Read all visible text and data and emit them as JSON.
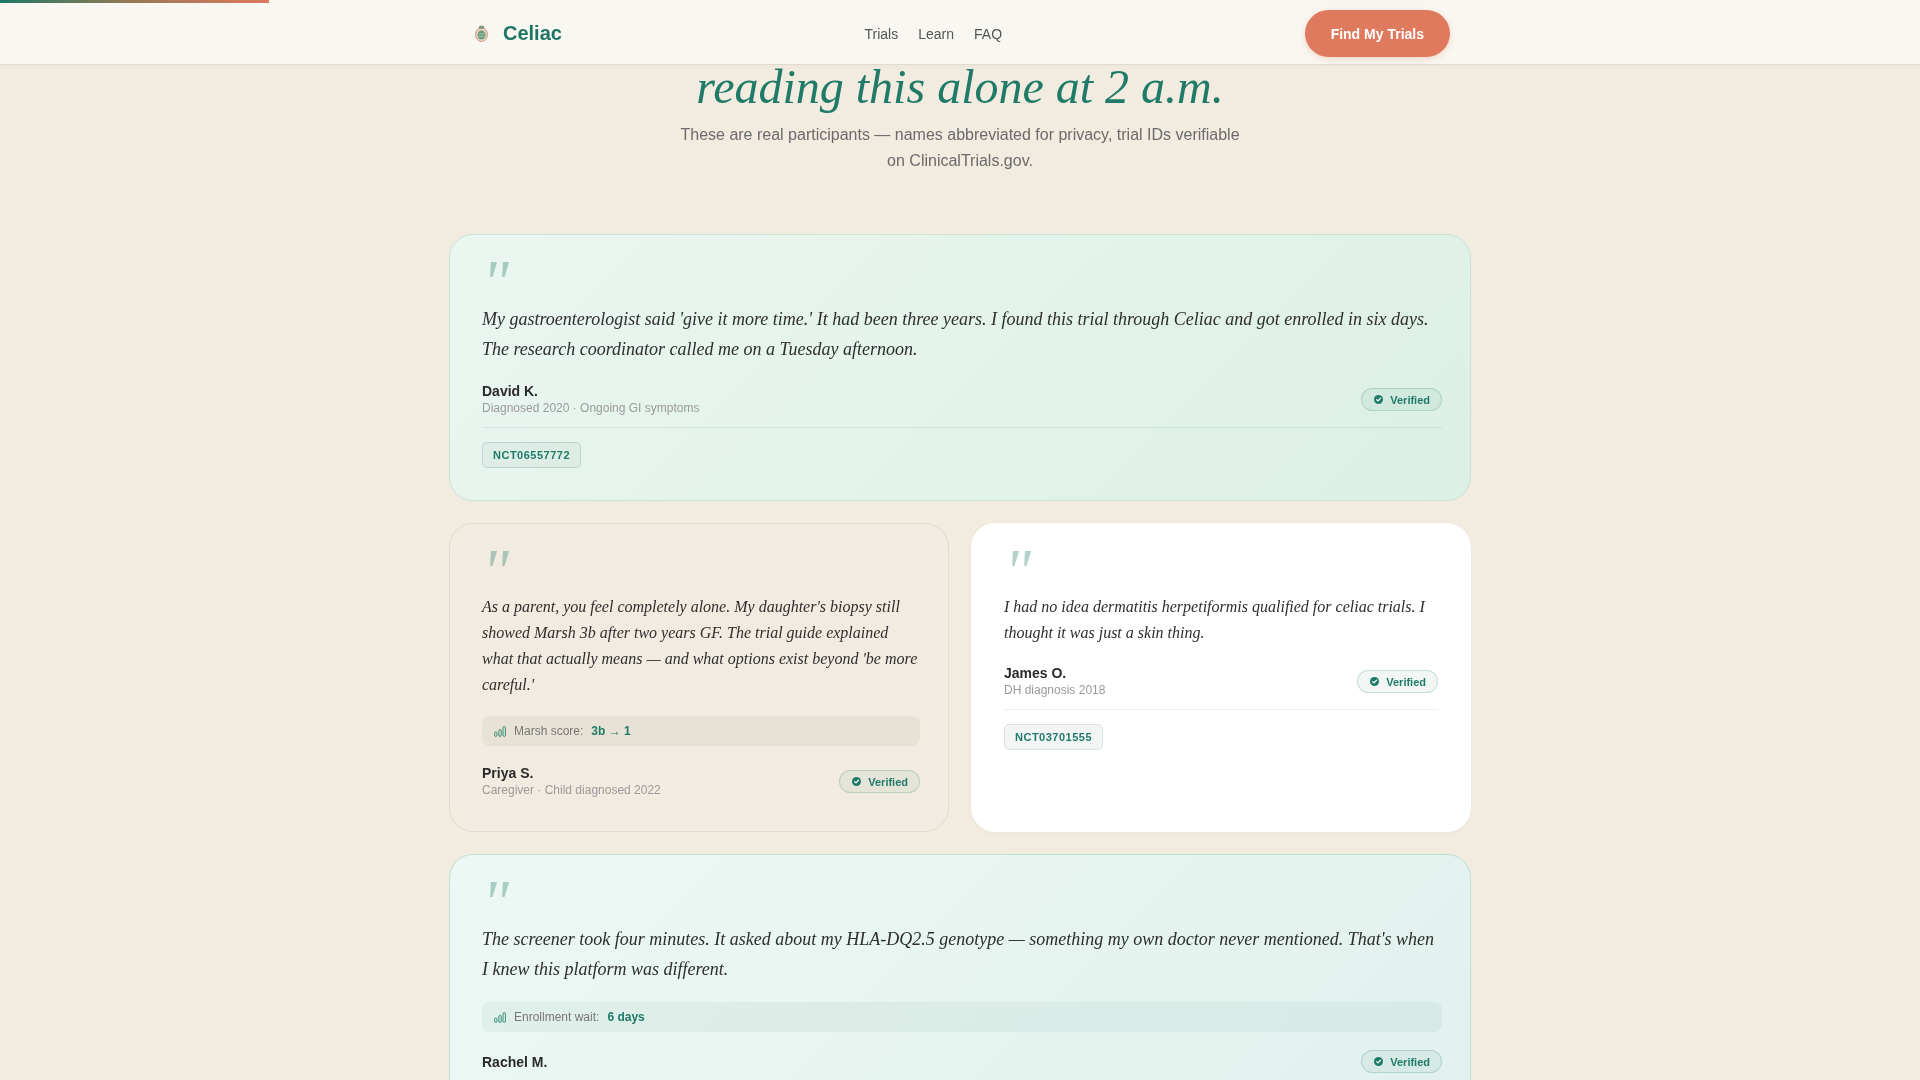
{
  "progress_bar": {
    "level": 0.14
  },
  "header": {
    "logo": "Celiac",
    "nav": [
      "Trials",
      "Learn",
      "FAQ"
    ],
    "cta": "Find My Trials"
  },
  "hero": {
    "headline": "reading this alone at 2 a.m.",
    "subtitle": "These are real participants — names abbreviated for privacy, trial IDs verifiable on ClinicalTrials.gov."
  },
  "testimonials": [
    {
      "kind": "featured",
      "quote_mark": "\"",
      "quote": "My gastroenterologist said 'give it more time.' It had been three years. I found this trial through Celiac and got enrolled in six days. The research coordinator called me on a Tuesday afternoon.",
      "name": "David K.",
      "meta": "Diagnosed 2020 · Ongoing GI symptoms",
      "badge": "Verified",
      "trial_id": "NCT06557772"
    },
    {
      "kind": "soft",
      "quote_mark": "\"",
      "quote": "As a parent, you feel completely alone. My daughter's biopsy still showed Marsh 3b after two years GF. The trial guide explained what that actually means — and what options exist beyond 'be more careful.'",
      "metric": {
        "label": "Marsh score:",
        "value": "3b → 1"
      },
      "name": "Priya S.",
      "meta": "Caregiver · Child diagnosed 2022",
      "badge": "Verified"
    },
    {
      "kind": "plain",
      "quote_mark": "\"",
      "quote": "I had no idea dermatitis herpetiformis qualified for celiac trials. I thought it was just a skin thing.",
      "name": "James O.",
      "meta": "DH diagnosis 2018",
      "badge": "Verified",
      "trial_id": "NCT03701555"
    },
    {
      "kind": "highlight",
      "quote_mark": "\"",
      "quote": "The screener took four minutes. It asked about my HLA-DQ2.5 genotype — something my own doctor never mentioned. That's when I knew this platform was different.",
      "metric": {
        "label": "Enrollment wait:",
        "value": "6 days"
      },
      "name": "Rachel M.",
      "badge": "Verified"
    }
  ]
}
